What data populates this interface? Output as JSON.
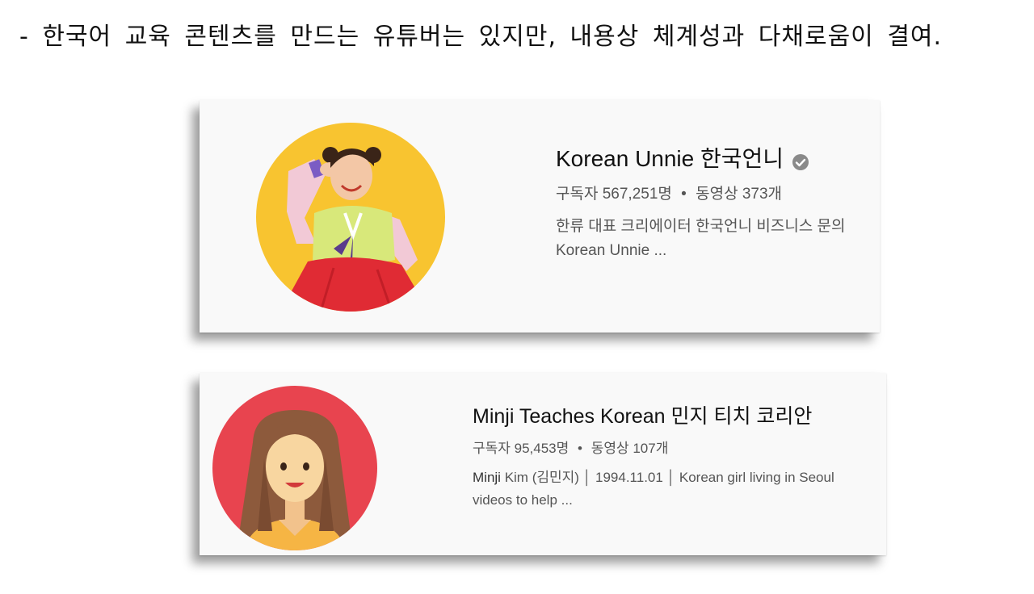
{
  "heading": "- 한국어 교육 콘텐츠를 만드는 유튜버는 있지만, 내용상 체계성과 다채로움이 결여.",
  "channels": [
    {
      "name": "Korean Unnie 한국언니",
      "verified": true,
      "subscribers": "구독자 567,251명",
      "separator": "•",
      "videos": "동영상 373개",
      "desc_line1": "한류 대표 크리에이터 한국언니 비즈니스 문의",
      "desc_line2": "Korean Unnie ...",
      "avatar_bg": "#f8c430",
      "verified_icon": "check-circle-icon"
    },
    {
      "name": "Minji Teaches Korean 민지 티치 코리안",
      "verified": false,
      "subscribers": "구독자 95,453명",
      "separator": "•",
      "videos": "동영상 107개",
      "desc_name": "Minji",
      "desc_line1": "Kim (김민지) │ 1994.11.01 │ Korean girl living in Seoul",
      "desc_line2": "videos to help ...",
      "avatar_bg": "#e8444f"
    }
  ]
}
